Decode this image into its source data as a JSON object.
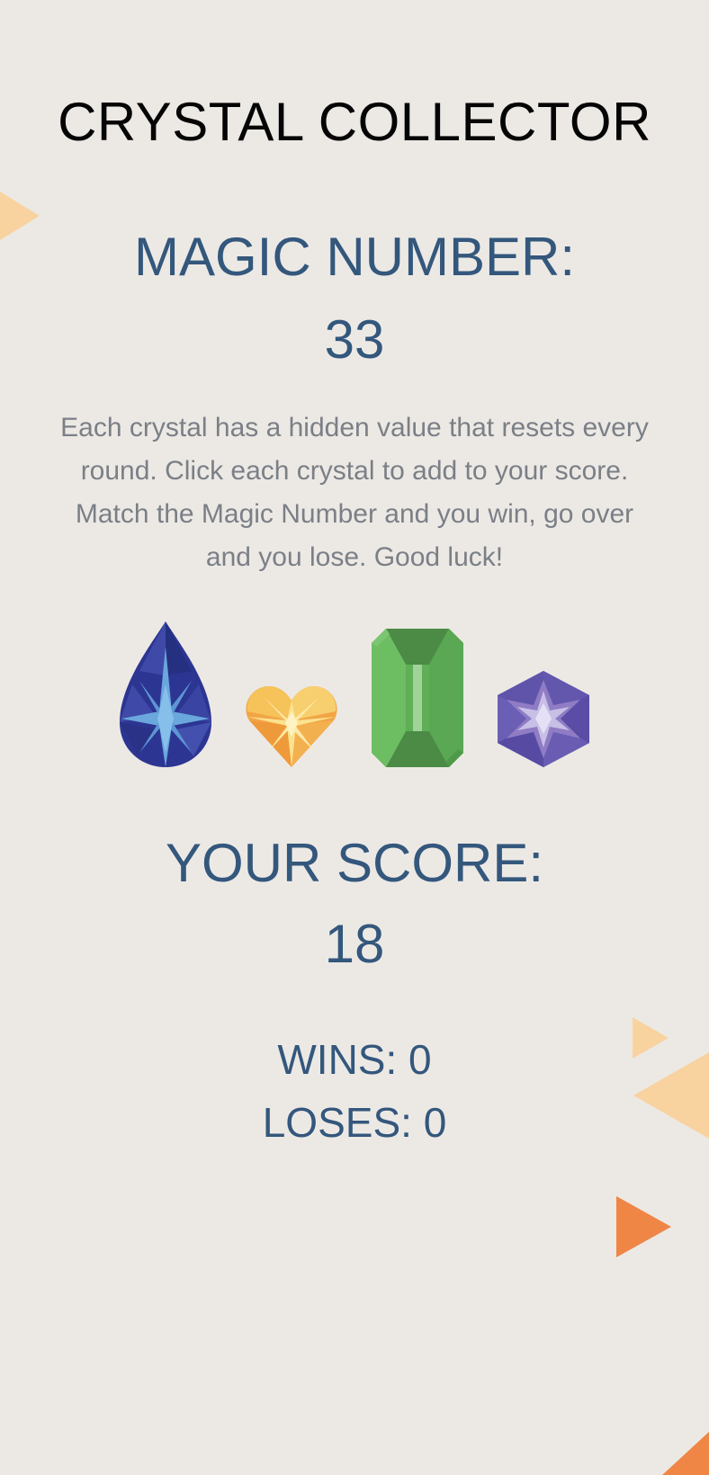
{
  "header": {
    "title": "CRYSTAL COLLECTOR"
  },
  "magic": {
    "label": "MAGIC NUMBER:",
    "value": "33"
  },
  "instructions": "Each crystal has a hidden value that resets every round. Click each crystal to add to your score. Match the Magic Number and you win, go over and you lose. Good luck!",
  "crystals": [
    {
      "name": "blue-teardrop-crystal",
      "color": "#3a3f9a"
    },
    {
      "name": "yellow-heart-crystal",
      "color": "#f3b64f"
    },
    {
      "name": "green-emerald-crystal",
      "color": "#5faf57"
    },
    {
      "name": "purple-hexagon-crystal",
      "color": "#5b4aa6"
    }
  ],
  "score": {
    "label": "YOUR SCORE:",
    "value": "18"
  },
  "stats": {
    "wins": "WINS: 0",
    "loses": "LOSES: 0"
  },
  "colors": {
    "background": "#ece9e5",
    "accent": "#34577c",
    "body_text": "#7b7f86",
    "deco_light": "#f8d3a0",
    "deco_dark": "#ef8646"
  }
}
